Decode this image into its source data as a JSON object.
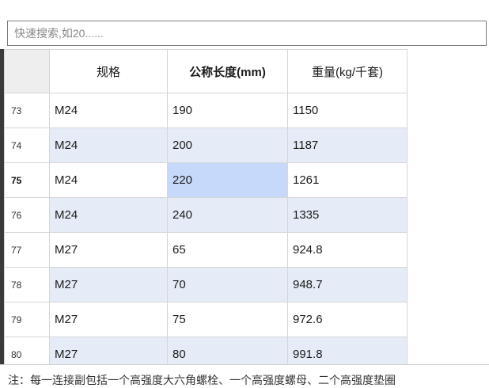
{
  "search": {
    "placeholder": "快速搜索,如20......",
    "value": ""
  },
  "table": {
    "headers": {
      "spec": "规格",
      "nominal_length": "公称长度(mm)",
      "weight": "重量(kg/千套)"
    },
    "rows": [
      {
        "num": "73",
        "spec": "M24",
        "length": "190",
        "weight": "1150"
      },
      {
        "num": "74",
        "spec": "M24",
        "length": "200",
        "weight": "1187"
      },
      {
        "num": "75",
        "spec": "M24",
        "length": "220",
        "weight": "1261"
      },
      {
        "num": "76",
        "spec": "M24",
        "length": "240",
        "weight": "1335"
      },
      {
        "num": "77",
        "spec": "M27",
        "length": "65",
        "weight": "924.8"
      },
      {
        "num": "78",
        "spec": "M27",
        "length": "70",
        "weight": "948.7"
      },
      {
        "num": "79",
        "spec": "M27",
        "length": "75",
        "weight": "972.6"
      },
      {
        "num": "80",
        "spec": "M27",
        "length": "80",
        "weight": "991.8"
      }
    ],
    "current_row": "75",
    "selected_cell": {
      "row": "75",
      "column": "nominal_length"
    }
  },
  "footer": {
    "note": "注：每一连接副包括一个高强度大六角螺栓、一个高强度螺母、二个高强度垫圈"
  },
  "colors": {
    "alt_row": "#e6ecf7",
    "selected_cell": "#c6d9fb",
    "header_corner": "#eeeeee"
  }
}
